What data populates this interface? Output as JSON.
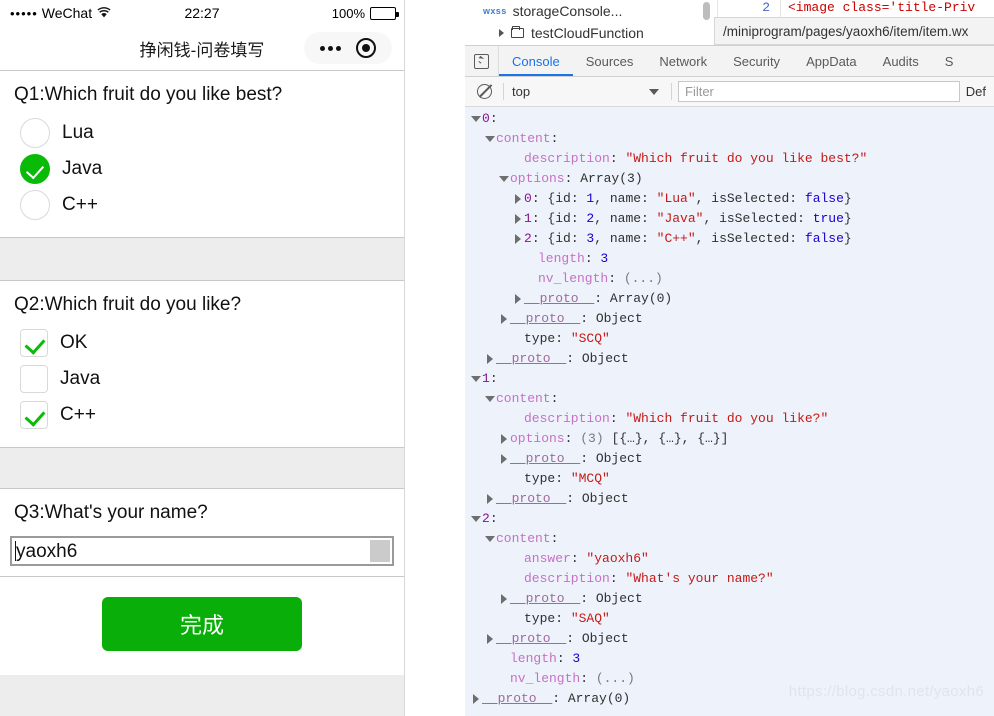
{
  "simulator": {
    "status_bar": {
      "signal_dots": "•••••",
      "carrier": "WeChat",
      "wifi_icon": "wifi-icon",
      "time": "22:27",
      "battery_percent": "100%",
      "battery_icon": "battery-full-icon"
    },
    "nav_bar": {
      "title": "挣闲钱-问卷填写",
      "menu_icon": "more-dots-icon",
      "target_icon": "target-circle-icon"
    },
    "questions": [
      {
        "title": "Q1:Which fruit do you like best?",
        "type": "SCQ",
        "control": "radio",
        "options": [
          {
            "label": "Lua",
            "selected": false
          },
          {
            "label": "Java",
            "selected": true
          },
          {
            "label": "C++",
            "selected": false
          }
        ]
      },
      {
        "title": "Q2:Which fruit do you like?",
        "type": "MCQ",
        "control": "checkbox",
        "options": [
          {
            "label": "OK",
            "selected": true
          },
          {
            "label": "Java",
            "selected": false
          },
          {
            "label": "C++",
            "selected": true
          }
        ]
      },
      {
        "title": "Q3:What's your name?",
        "type": "SAQ",
        "control": "text",
        "value": "yaoxh6",
        "placeholder": ""
      }
    ],
    "submit_label": "完成",
    "accent_color": "#09bb07",
    "submit_color": "#09ae09"
  },
  "devtools": {
    "file_tree": [
      {
        "icon": "wxss-file-icon",
        "label": "storageConsole...",
        "expandable": false
      },
      {
        "icon": "folder-icon",
        "label": "testCloudFunction",
        "expandable": true
      }
    ],
    "editor_sliver": {
      "line_number": "2",
      "code": "<image class='title-Priv"
    },
    "path_tooltip": "/miniprogram/pages/yaoxh6/item/item.wx",
    "inspect_icon": "inspect-cursor-icon",
    "tabs": [
      {
        "label": "Console",
        "active": true
      },
      {
        "label": "Sources",
        "active": false
      },
      {
        "label": "Network",
        "active": false
      },
      {
        "label": "Security",
        "active": false
      },
      {
        "label": "AppData",
        "active": false
      },
      {
        "label": "Audits",
        "active": false
      },
      {
        "label": "S",
        "active": false
      }
    ],
    "toolbar": {
      "clear_icon": "clear-console-icon",
      "context": "top",
      "context_caret": "chevron-down-icon",
      "filter_placeholder": "Filter",
      "levels_label": "Def"
    },
    "active_tab_color": "#1a73e8",
    "watermark": "https://blog.csdn.net/yaoxh6",
    "console_lines": [
      {
        "indent": 0,
        "arrow": "down",
        "parts": [
          {
            "t": "0",
            "c": "k-idx"
          },
          {
            "t": ":",
            "c": "k-plain"
          }
        ]
      },
      {
        "indent": 1,
        "arrow": "down",
        "parts": [
          {
            "t": "content",
            "c": "k-prop"
          },
          {
            "t": ":",
            "c": "k-plain"
          }
        ]
      },
      {
        "indent": 3,
        "arrow": "none",
        "parts": [
          {
            "t": "description",
            "c": "k-prop"
          },
          {
            "t": ": ",
            "c": "k-plain"
          },
          {
            "t": "\"Which fruit do you like best?\"",
            "c": "v-str"
          }
        ]
      },
      {
        "indent": 2,
        "arrow": "down",
        "parts": [
          {
            "t": "options",
            "c": "k-prop"
          },
          {
            "t": ": ",
            "c": "k-plain"
          },
          {
            "t": "Array(3)",
            "c": "v-obj"
          }
        ]
      },
      {
        "indent": 3,
        "arrow": "right",
        "parts": [
          {
            "t": "0",
            "c": "k-idx"
          },
          {
            "t": ": {id: ",
            "c": "k-plain"
          },
          {
            "t": "1",
            "c": "v-num"
          },
          {
            "t": ", name: ",
            "c": "k-plain"
          },
          {
            "t": "\"Lua\"",
            "c": "v-str"
          },
          {
            "t": ", isSelected: ",
            "c": "k-plain"
          },
          {
            "t": "false",
            "c": "v-bool"
          },
          {
            "t": "}",
            "c": "k-plain"
          }
        ]
      },
      {
        "indent": 3,
        "arrow": "right",
        "parts": [
          {
            "t": "1",
            "c": "k-idx"
          },
          {
            "t": ": {id: ",
            "c": "k-plain"
          },
          {
            "t": "2",
            "c": "v-num"
          },
          {
            "t": ", name: ",
            "c": "k-plain"
          },
          {
            "t": "\"Java\"",
            "c": "v-str"
          },
          {
            "t": ", isSelected: ",
            "c": "k-plain"
          },
          {
            "t": "true",
            "c": "v-bool"
          },
          {
            "t": "}",
            "c": "k-plain"
          }
        ]
      },
      {
        "indent": 3,
        "arrow": "right",
        "parts": [
          {
            "t": "2",
            "c": "k-idx"
          },
          {
            "t": ": {id: ",
            "c": "k-plain"
          },
          {
            "t": "3",
            "c": "v-num"
          },
          {
            "t": ", name: ",
            "c": "k-plain"
          },
          {
            "t": "\"C++\"",
            "c": "v-str"
          },
          {
            "t": ", isSelected: ",
            "c": "k-plain"
          },
          {
            "t": "false",
            "c": "v-bool"
          },
          {
            "t": "}",
            "c": "k-plain"
          }
        ]
      },
      {
        "indent": 4,
        "arrow": "none",
        "parts": [
          {
            "t": "length",
            "c": "k-prop"
          },
          {
            "t": ": ",
            "c": "k-plain"
          },
          {
            "t": "3",
            "c": "v-num"
          }
        ]
      },
      {
        "indent": 4,
        "arrow": "none",
        "parts": [
          {
            "t": "nv_length",
            "c": "k-prop"
          },
          {
            "t": ": ",
            "c": "k-plain"
          },
          {
            "t": "(...)",
            "c": "v-dim"
          }
        ]
      },
      {
        "indent": 3,
        "arrow": "right",
        "parts": [
          {
            "t": "__proto__",
            "c": "k-proto"
          },
          {
            "t": ": ",
            "c": "k-plain"
          },
          {
            "t": "Array(0)",
            "c": "v-obj"
          }
        ]
      },
      {
        "indent": 2,
        "arrow": "right",
        "parts": [
          {
            "t": "__proto__",
            "c": "k-proto"
          },
          {
            "t": ": ",
            "c": "k-plain"
          },
          {
            "t": "Object",
            "c": "v-obj"
          }
        ]
      },
      {
        "indent": 3,
        "arrow": "none",
        "parts": [
          {
            "t": "type",
            "c": "k-plain"
          },
          {
            "t": ": ",
            "c": "k-plain"
          },
          {
            "t": "\"SCQ\"",
            "c": "v-str"
          }
        ]
      },
      {
        "indent": 1,
        "arrow": "right",
        "parts": [
          {
            "t": "__proto__",
            "c": "k-proto"
          },
          {
            "t": ": ",
            "c": "k-plain"
          },
          {
            "t": "Object",
            "c": "v-obj"
          }
        ]
      },
      {
        "indent": 0,
        "arrow": "down",
        "parts": [
          {
            "t": "1",
            "c": "k-idx"
          },
          {
            "t": ":",
            "c": "k-plain"
          }
        ]
      },
      {
        "indent": 1,
        "arrow": "down",
        "parts": [
          {
            "t": "content",
            "c": "k-prop"
          },
          {
            "t": ":",
            "c": "k-plain"
          }
        ]
      },
      {
        "indent": 3,
        "arrow": "none",
        "parts": [
          {
            "t": "description",
            "c": "k-prop"
          },
          {
            "t": ": ",
            "c": "k-plain"
          },
          {
            "t": "\"Which fruit do you like?\"",
            "c": "v-str"
          }
        ]
      },
      {
        "indent": 2,
        "arrow": "right",
        "parts": [
          {
            "t": "options",
            "c": "k-prop"
          },
          {
            "t": ": ",
            "c": "k-plain"
          },
          {
            "t": "(3) ",
            "c": "v-dim"
          },
          {
            "t": "[{…}, {…}, {…}]",
            "c": "v-obj"
          }
        ]
      },
      {
        "indent": 2,
        "arrow": "right",
        "parts": [
          {
            "t": "__proto__",
            "c": "k-proto"
          },
          {
            "t": ": ",
            "c": "k-plain"
          },
          {
            "t": "Object",
            "c": "v-obj"
          }
        ]
      },
      {
        "indent": 3,
        "arrow": "none",
        "parts": [
          {
            "t": "type",
            "c": "k-plain"
          },
          {
            "t": ": ",
            "c": "k-plain"
          },
          {
            "t": "\"MCQ\"",
            "c": "v-str"
          }
        ]
      },
      {
        "indent": 1,
        "arrow": "right",
        "parts": [
          {
            "t": "__proto__",
            "c": "k-proto"
          },
          {
            "t": ": ",
            "c": "k-plain"
          },
          {
            "t": "Object",
            "c": "v-obj"
          }
        ]
      },
      {
        "indent": 0,
        "arrow": "down",
        "parts": [
          {
            "t": "2",
            "c": "k-idx"
          },
          {
            "t": ":",
            "c": "k-plain"
          }
        ]
      },
      {
        "indent": 1,
        "arrow": "down",
        "parts": [
          {
            "t": "content",
            "c": "k-prop"
          },
          {
            "t": ":",
            "c": "k-plain"
          }
        ]
      },
      {
        "indent": 3,
        "arrow": "none",
        "parts": [
          {
            "t": "answer",
            "c": "k-prop"
          },
          {
            "t": ": ",
            "c": "k-plain"
          },
          {
            "t": "\"yaoxh6\"",
            "c": "v-str"
          }
        ]
      },
      {
        "indent": 3,
        "arrow": "none",
        "parts": [
          {
            "t": "description",
            "c": "k-prop"
          },
          {
            "t": ": ",
            "c": "k-plain"
          },
          {
            "t": "\"What's your name?\"",
            "c": "v-str"
          }
        ]
      },
      {
        "indent": 2,
        "arrow": "right",
        "parts": [
          {
            "t": "__proto__",
            "c": "k-proto"
          },
          {
            "t": ": ",
            "c": "k-plain"
          },
          {
            "t": "Object",
            "c": "v-obj"
          }
        ]
      },
      {
        "indent": 3,
        "arrow": "none",
        "parts": [
          {
            "t": "type",
            "c": "k-plain"
          },
          {
            "t": ": ",
            "c": "k-plain"
          },
          {
            "t": "\"SAQ\"",
            "c": "v-str"
          }
        ]
      },
      {
        "indent": 1,
        "arrow": "right",
        "parts": [
          {
            "t": "__proto__",
            "c": "k-proto"
          },
          {
            "t": ": ",
            "c": "k-plain"
          },
          {
            "t": "Object",
            "c": "v-obj"
          }
        ]
      },
      {
        "indent": 2,
        "arrow": "none",
        "parts": [
          {
            "t": "length",
            "c": "k-prop"
          },
          {
            "t": ": ",
            "c": "k-plain"
          },
          {
            "t": "3",
            "c": "v-num"
          }
        ]
      },
      {
        "indent": 2,
        "arrow": "none",
        "parts": [
          {
            "t": "nv_length",
            "c": "k-prop"
          },
          {
            "t": ": ",
            "c": "k-plain"
          },
          {
            "t": "(...)",
            "c": "v-dim"
          }
        ]
      },
      {
        "indent": 0,
        "arrow": "right",
        "parts": [
          {
            "t": "__proto__",
            "c": "k-proto"
          },
          {
            "t": ": ",
            "c": "k-plain"
          },
          {
            "t": "Array(0)",
            "c": "v-obj"
          }
        ]
      }
    ]
  }
}
